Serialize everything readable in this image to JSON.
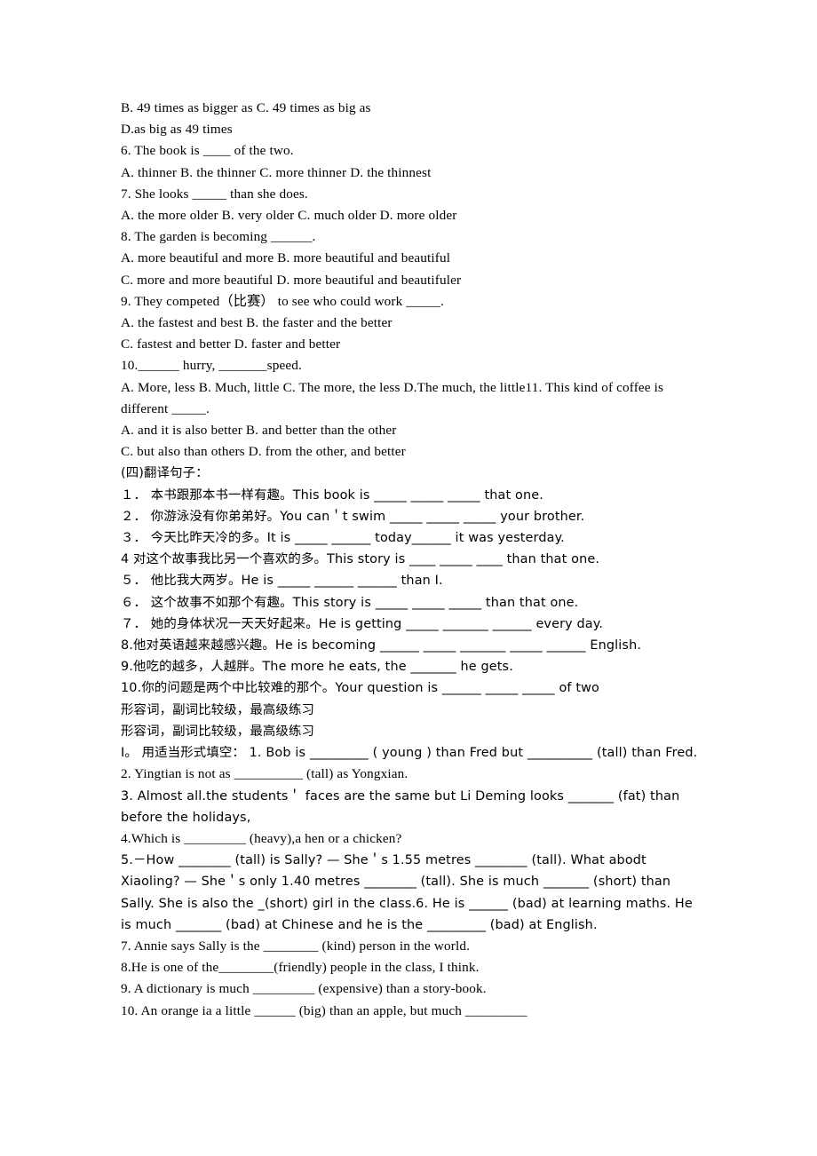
{
  "document": {
    "title": "形容词，副词比较级，最高级练习",
    "background_color": "#ffffff",
    "text_color": "#000000",
    "lines": [
      {
        "id": "l01",
        "text": "B. 49 times as bigger as C. 49 times as big as"
      },
      {
        "id": "l02",
        "text": "D.as big as 49 times"
      },
      {
        "id": "l03",
        "text": "6. The book is ____ of the two."
      },
      {
        "id": "l04",
        "text": "A. thinner B. the thinner C. more thinner D. the thinnest"
      },
      {
        "id": "l05",
        "text": "7. She looks _____ than she does."
      },
      {
        "id": "l06",
        "text": "A. the more older B. very older C. much older D. more older"
      },
      {
        "id": "l07",
        "text": "8. The garden is becoming ______."
      },
      {
        "id": "l08",
        "text": "A. more beautiful and more B. more beautiful and beautiful"
      },
      {
        "id": "l09",
        "text": "C. more and more beautiful D. more beautiful and beautifuler"
      },
      {
        "id": "l10",
        "text": "9. They competed（比赛） to see who could work _____."
      },
      {
        "id": "l11",
        "text": "A. the fastest and best B. the faster and the better"
      },
      {
        "id": "l12",
        "text": "C. fastest and better D. faster and better"
      },
      {
        "id": "l13",
        "text": "10.______ hurry, _______speed."
      },
      {
        "id": "l14",
        "text": "A. More, less B. Much, little C. The more, the less D.The much, the little11. This kind of coffee is different _____."
      },
      {
        "id": "l15",
        "text": "A. and it is also better B. and better than the other"
      },
      {
        "id": "l16",
        "text": "C. but also than others D. from the other, and better"
      },
      {
        "id": "l17",
        "text": "(四)翻译句子："
      },
      {
        "id": "l18",
        "text": "１． 本书跟那本书一样有趣。This book is _____ _____ _____ that one."
      },
      {
        "id": "l19",
        "text": "２． 你游泳没有你弟弟好。You can＇t swim _____ _____ _____ your brother."
      },
      {
        "id": "l20",
        "text": "３． 今天比昨天冷的多。It is _____ ______ today______ it was yesterday."
      },
      {
        "id": "l21",
        "text": "4 对这个故事我比另一个喜欢的多。This story is ____ _____ ____ than that one."
      },
      {
        "id": "l22",
        "text": "５． 他比我大两岁。He is _____ ______ ______ than I."
      },
      {
        "id": "l23",
        "text": "６． 这个故事不如那个有趣。This story is _____ _____ _____ than that one."
      },
      {
        "id": "l24",
        "text": "７． 她的身体状况一天天好起来。He is getting _____ _______ ______ every day."
      },
      {
        "id": "l25",
        "text": "8.他对英语越来越感兴趣。He is becoming ______ _____ _______ _____ ______ English."
      },
      {
        "id": "l26",
        "text": "9.他吃的越多，人越胖。The more he eats, the _______ he gets."
      },
      {
        "id": "l27",
        "text": "10.你的问题是两个中比较难的那个。Your question is ______ _____ _____ of two"
      },
      {
        "id": "l28",
        "text": "形容词，副词比较级，最高级练习"
      },
      {
        "id": "l29",
        "text": "形容词，副词比较级，最高级练习"
      },
      {
        "id": "l30",
        "text": "Ⅰ。 用适当形式填空： 1. Bob is _________ ( young ) than Fred but __________ (tall) than Fred."
      },
      {
        "id": "l31",
        "text": "2. Yingtian is not as __________ (tall) as Yongxian."
      },
      {
        "id": "l32",
        "text": "3. Almost all.the students＇ faces are the same but Li Deming looks _______ (fat) than before the holidays,"
      },
      {
        "id": "l33",
        "text": "4.Which is _________ (heavy),a hen or a chicken?"
      },
      {
        "id": "l34",
        "text": "5.－How ________ (tall) is Sally? — She＇s 1.55 metres ________ (tall). What abodt Xiaoling? — She＇s only 1.40 metres ________ (tall). She is much _______ (short) than Sally. She is also the _(short) girl in the class.6. He is ______ (bad) at learning maths. He is much _______ (bad) at Chinese and he is the _________ (bad) at English."
      },
      {
        "id": "l35",
        "text": "7. Annie says Sally is the ________ (kind) person in the world."
      },
      {
        "id": "l36",
        "text": "8.He is one of the________(friendly) people in the class, I think."
      },
      {
        "id": "l37",
        "text": "9. A dictionary is much _________ (expensive) than a story-book."
      },
      {
        "id": "l38",
        "text": "10. An orange ia a little ______ (big) than an apple, but much _________"
      }
    ]
  }
}
